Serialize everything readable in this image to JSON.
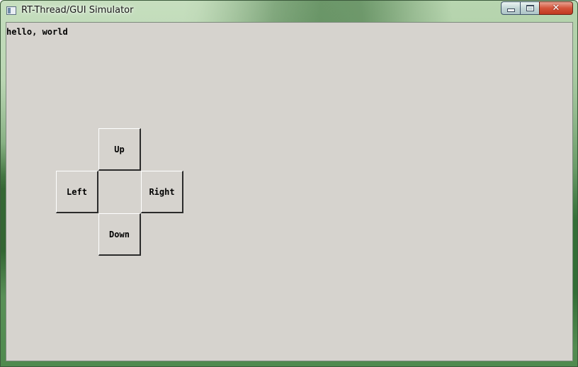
{
  "window": {
    "title": "RT-Thread/GUI Simulator",
    "caption": {
      "minimize_icon": "minimize-icon",
      "maximize_icon": "maximize-icon",
      "close_label": "✕"
    }
  },
  "client": {
    "background": "#d6d3ce",
    "greeting": "hello, world",
    "dpad": {
      "up_label": "Up",
      "left_label": "Left",
      "right_label": "Right",
      "down_label": "Down"
    }
  }
}
